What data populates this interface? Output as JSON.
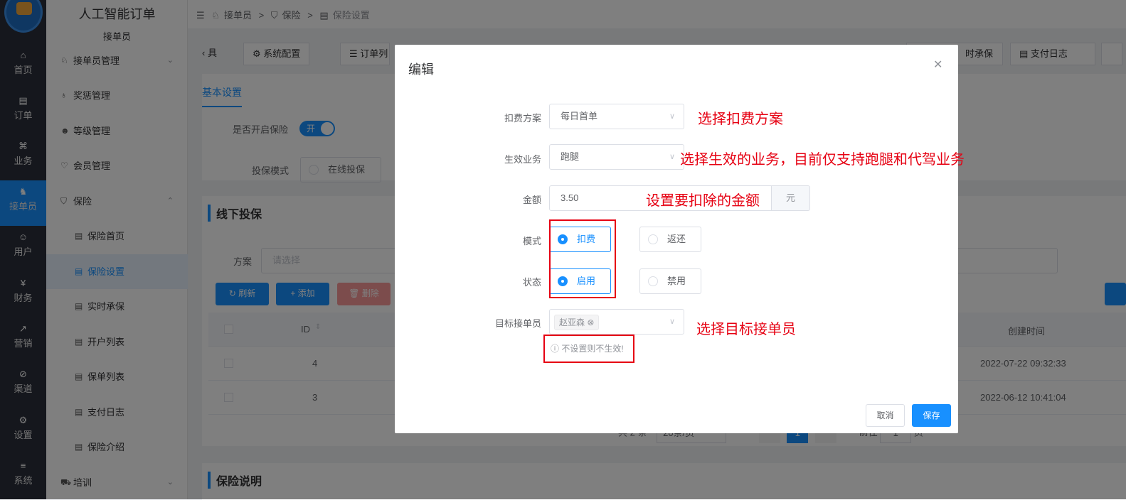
{
  "rail": {
    "items": [
      {
        "label": "首页",
        "icon": "home-icon"
      },
      {
        "label": "订单",
        "icon": "order-icon"
      },
      {
        "label": "业务",
        "icon": "grid-icon"
      },
      {
        "label": "接单员",
        "icon": "rider-icon"
      },
      {
        "label": "用户",
        "icon": "user-icon"
      },
      {
        "label": "财务",
        "icon": "finance-icon"
      },
      {
        "label": "营销",
        "icon": "chart-icon"
      },
      {
        "label": "渠道",
        "icon": "compass-icon"
      },
      {
        "label": "设置",
        "icon": "gear-icon"
      },
      {
        "label": "系统",
        "icon": "sliders-icon"
      }
    ],
    "active_index": 3
  },
  "menu": {
    "title": "人工智能订单",
    "subtitle": "接单员",
    "items": [
      {
        "label": "接单员管理",
        "arrow": "⌄"
      },
      {
        "label": "奖惩管理"
      },
      {
        "label": "等级管理"
      },
      {
        "label": "会员管理"
      },
      {
        "label": "保险",
        "arrow": "⌃"
      },
      {
        "label": "保险首页"
      },
      {
        "label": "保险设置"
      },
      {
        "label": "实时承保"
      },
      {
        "label": "开户列表"
      },
      {
        "label": "保单列表"
      },
      {
        "label": "支付日志"
      },
      {
        "label": "保险介绍"
      },
      {
        "label": "培训",
        "arrow": "⌄"
      }
    ]
  },
  "breadcrumb": [
    "接单员",
    "保险",
    "保险设置"
  ],
  "tabs": [
    "具",
    "系统配置",
    "订单列",
    "时承保",
    "支付日志"
  ],
  "page": {
    "sub_tab": "基本设置",
    "enable_label": "是否开启保险",
    "enable_value": "开",
    "mode_label": "投保模式",
    "mode_value": "在线投保",
    "section_offline": "线下投保",
    "filter_label": "方案",
    "filter_placeholder": "请选择",
    "btn_refresh": "刷新",
    "btn_add": "添加",
    "btn_delete": "删除",
    "col_id": "ID",
    "col_created": "创建时间",
    "rows": [
      {
        "id": "4",
        "created": "2022-07-22 09:32:33"
      },
      {
        "id": "3",
        "created": "2022-06-12 10:41:04"
      }
    ],
    "pager_total": "共 2 条",
    "pager_size": "20条/页",
    "pager_page": "1",
    "pager_goto": "前往",
    "pager_goto_val": "1",
    "pager_unit": "页",
    "section_desc": "保险说明"
  },
  "modal": {
    "title": "编辑",
    "fields": {
      "plan_label": "扣费方案",
      "plan_value": "每日首单",
      "business_label": "生效业务",
      "business_value": "跑腿",
      "amount_label": "金额",
      "amount_value": "3.50",
      "amount_unit": "元",
      "mode_label": "模式",
      "mode_opt1": "扣费",
      "mode_opt2": "返还",
      "status_label": "状态",
      "status_opt1": "启用",
      "status_opt2": "禁用",
      "target_label": "目标接单员",
      "target_tag": "赵亚森",
      "hint": "不设置则不生效!"
    },
    "cancel": "取消",
    "save": "保存"
  },
  "annotations": {
    "a1": "选择扣费方案",
    "a2": "选择生效的业务，目前仅支持跑腿和代驾业务",
    "a3": "设置要扣除的金额",
    "a4": "选择目标接单员"
  },
  "colors": {
    "primary": "#1890ff",
    "annotation": "#e60012",
    "rail": "#2b2f3a"
  }
}
